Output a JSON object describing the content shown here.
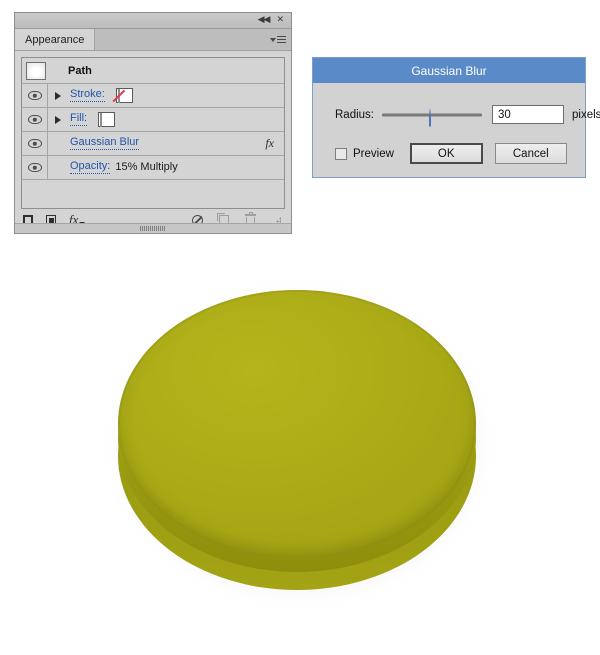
{
  "panel": {
    "titlebar": {
      "collapse_icon": "collapse-double-arrow-icon",
      "close_icon": "close-icon"
    },
    "tab_label": "Appearance",
    "menu_icon": "panel-menu-icon",
    "header_row": {
      "thumbnail": "path-thumbnail",
      "title": "Path"
    },
    "rows": [
      {
        "label": "Stroke:",
        "value": "",
        "has_eye": true,
        "has_disclosure": true,
        "swatch": "none",
        "fx": false
      },
      {
        "label": "Fill:",
        "value": "",
        "has_eye": true,
        "has_disclosure": true,
        "swatch": "black",
        "fx": false
      },
      {
        "label": "Gaussian Blur",
        "value": "",
        "has_eye": true,
        "has_disclosure": false,
        "swatch": "",
        "fx": true,
        "fx_label": "fx"
      },
      {
        "label": "Opacity:",
        "value": "15% Multiply",
        "has_eye": true,
        "has_disclosure": false,
        "swatch": "",
        "fx": false
      }
    ],
    "toolbar": {
      "new_stroke_icon": "new-stroke-icon",
      "new_fill_icon": "new-fill-icon",
      "fx_label": "fx",
      "clear_appearance_icon": "clear-appearance-icon",
      "duplicate_icon": "duplicate-item-icon",
      "delete_icon": "delete-item-icon",
      "resize_grip_icon": "resize-grip-icon"
    }
  },
  "dialog": {
    "title": "Gaussian Blur",
    "radius_label": "Radius:",
    "radius_value": "30",
    "units_label": "pixels",
    "preview_label": "Preview",
    "preview_checked": false,
    "ok_label": "OK",
    "cancel_label": "Cancel",
    "title_bar_color": "#5b8ac9"
  },
  "artwork": {
    "name": "olive-3d-disc",
    "fill_color": "#a8a817",
    "side_color": "#8f8f0d"
  }
}
